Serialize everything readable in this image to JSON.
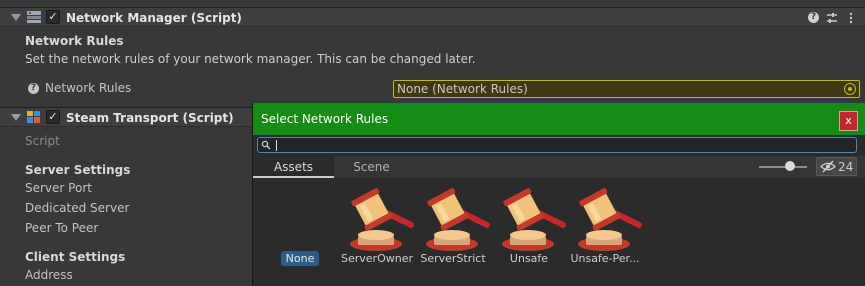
{
  "network_manager": {
    "title": "Network Manager (Script)",
    "enabled": "✓",
    "section_title": "Network Rules",
    "description": "Set the network rules of your network manager. This can be changed later.",
    "field_label": "Network Rules",
    "field_value": "None (Network Rules)"
  },
  "steam_transport": {
    "title": "Steam Transport (Script)",
    "enabled": "✓",
    "script_label": "Script",
    "server_settings_title": "Server Settings",
    "server_port_label": "Server Port",
    "dedicated_server_label": "Dedicated Server",
    "peer_to_peer_label": "Peer To Peer",
    "client_settings_title": "Client Settings",
    "address_label": "Address"
  },
  "icons": {
    "help": "help-icon",
    "presets": "presets-icon",
    "menu": "kebab-menu-icon",
    "close": "close-icon",
    "search": "search-icon",
    "visibility": "eye-slash-icon",
    "asset": "gavel-icon"
  },
  "popup": {
    "title": "Select Network Rules",
    "close_label": "x",
    "search_value": "",
    "tabs": [
      {
        "label": "Assets",
        "active": true
      },
      {
        "label": "Scene",
        "active": false
      }
    ],
    "item_count": "24",
    "none_label": "None",
    "items": [
      {
        "label": "ServerOwner"
      },
      {
        "label": "ServerStrict"
      },
      {
        "label": "Unsafe"
      },
      {
        "label": "Unsafe-Per..."
      }
    ]
  },
  "colors": {
    "titlebar": "#168b16",
    "close": "#c0282d",
    "field_highlight": "#c6b718",
    "selection": "#2c5d88"
  }
}
